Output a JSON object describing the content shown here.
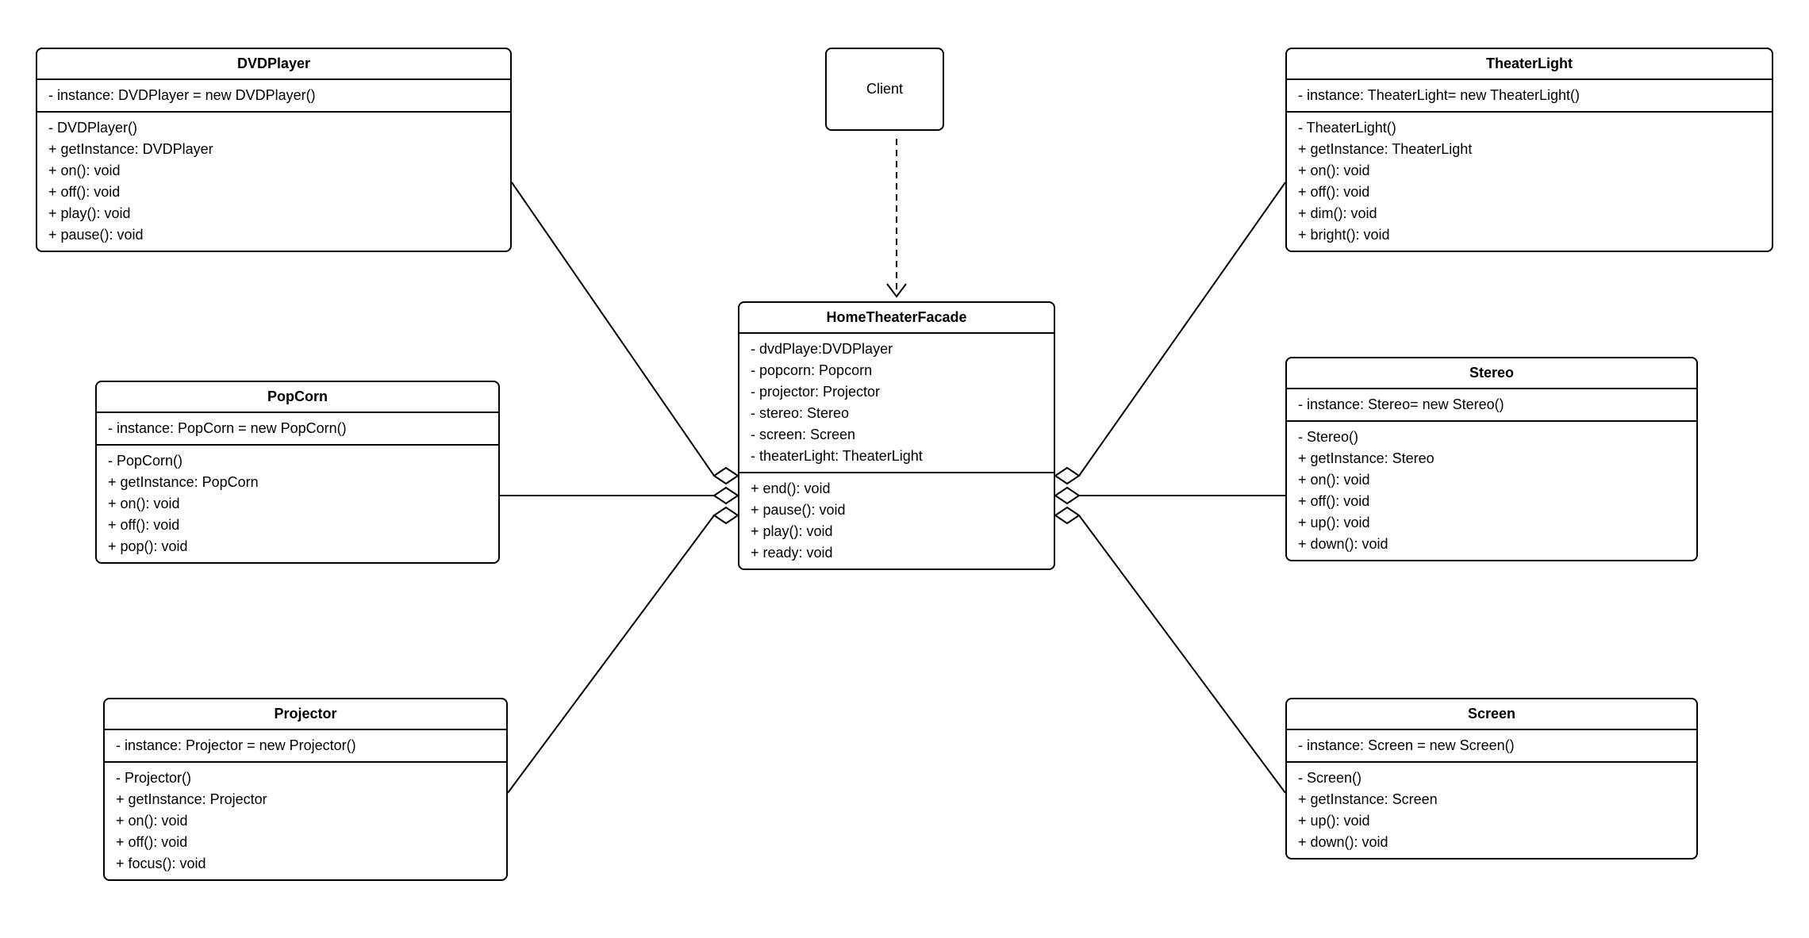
{
  "client": {
    "title": "Client"
  },
  "facade": {
    "title": "HomeTheaterFacade",
    "attrs": [
      "- dvdPlaye:DVDPlayer",
      "- popcorn: Popcorn",
      "- projector: Projector",
      "- stereo: Stereo",
      "- screen: Screen",
      "- theaterLight: TheaterLight"
    ],
    "ops": [
      "+ end(): void",
      "+ pause(): void",
      "+ play(): void",
      "+ ready: void"
    ]
  },
  "dvdplayer": {
    "title": "DVDPlayer",
    "attrs": [
      "- instance: DVDPlayer = new DVDPlayer()"
    ],
    "ops": [
      "-  DVDPlayer()",
      "+ getInstance: DVDPlayer",
      "+ on(): void",
      "+ off(): void",
      "+ play(): void",
      "+ pause(): void"
    ]
  },
  "popcorn": {
    "title": "PopCorn",
    "attrs": [
      "- instance: PopCorn = new PopCorn()"
    ],
    "ops": [
      "-  PopCorn()",
      "+ getInstance: PopCorn",
      "+ on(): void",
      "+ off(): void",
      "+ pop(): void"
    ]
  },
  "projector": {
    "title": "Projector",
    "attrs": [
      "- instance: Projector = new Projector()"
    ],
    "ops": [
      "-  Projector()",
      "+ getInstance: Projector",
      "+ on(): void",
      "+ off(): void",
      "+ focus(): void"
    ]
  },
  "theaterlight": {
    "title": "TheaterLight",
    "attrs": [
      "- instance: TheaterLight= new TheaterLight()"
    ],
    "ops": [
      "-  TheaterLight()",
      "+ getInstance: TheaterLight",
      "+ on(): void",
      "+ off(): void",
      "+ dim(): void",
      "+ bright(): void"
    ]
  },
  "stereo": {
    "title": "Stereo",
    "attrs": [
      "- instance: Stereo= new Stereo()"
    ],
    "ops": [
      "-  Stereo()",
      "+ getInstance: Stereo",
      "+ on(): void",
      "+ off(): void",
      "+ up(): void",
      "+ down(): void"
    ]
  },
  "screen": {
    "title": "Screen",
    "attrs": [
      "- instance: Screen = new Screen()"
    ],
    "ops": [
      "-  Screen()",
      "+ getInstance: Screen",
      "+ up(): void",
      "+ down(): void"
    ]
  }
}
